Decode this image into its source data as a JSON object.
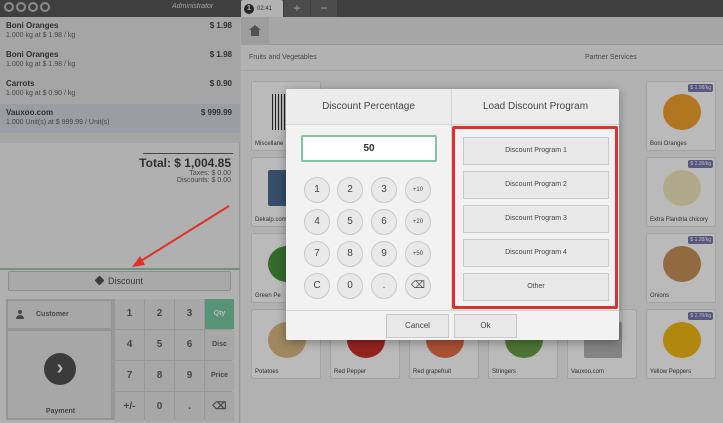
{
  "topbar": {
    "user": "Administrator",
    "order_number": "1",
    "order_time": "02:41",
    "add_order_glyph": "+",
    "remove_order_glyph": "−"
  },
  "orderlines": [
    {
      "name": "Boni Oranges",
      "price": "$ 1.98",
      "info": "1.000 kg at $ 1.98 / kg"
    },
    {
      "name": "Boni Oranges",
      "price": "$ 1.98",
      "info": "1.000 kg at $ 1.98 / kg"
    },
    {
      "name": "Carrots",
      "price": "$ 0.90",
      "info": "1.000 kg at $ 0.90 / kg"
    },
    {
      "name": "Vauxoo.com",
      "price": "$ 999.99",
      "info": "1.000 Unit(s) at $ 999.99 / Unit(s)"
    }
  ],
  "totals": {
    "total": "Total: $ 1,004.85",
    "taxes": "Taxes: $ 0.00",
    "discounts": "Discounts: $ 0.00"
  },
  "discount_button": "Discount",
  "actionpad": {
    "customer": "Customer",
    "payment": "Payment",
    "payment_glyph": "›"
  },
  "numpad": [
    "1",
    "2",
    "3",
    "Qty",
    "4",
    "5",
    "6",
    "Disc",
    "7",
    "8",
    "9",
    "Price",
    "+/-",
    "0",
    ".",
    "⌫"
  ],
  "products_header": {
    "category_left": "Fruits and Vegetables",
    "category_right": "Partner Services"
  },
  "product_tiles": [
    {
      "name": "Miscellane",
      "price": ""
    },
    {
      "name": "Boni Oranges",
      "price": "$ 1.98/kg"
    },
    {
      "name": "Dekalp.com",
      "price": ""
    },
    {
      "name": "Extra Flandria chicory",
      "price": "$ 2.20/kg"
    },
    {
      "name": "Green Pe",
      "price": ""
    },
    {
      "name": "Onions",
      "price": "$ 1.28/kg"
    },
    {
      "name": "Potatoes",
      "price": ""
    },
    {
      "name": "Red Pepper",
      "price": ""
    },
    {
      "name": "Red grapefruit",
      "price": ""
    },
    {
      "name": "Stringers",
      "price": ""
    },
    {
      "name": "Vauxoo.com",
      "price": ""
    },
    {
      "name": "Yellow Peppers",
      "price": "$ 2.70/kg"
    }
  ],
  "popup": {
    "tab_percentage": "Discount Percentage",
    "tab_program": "Load Discount Program",
    "input_value": "50",
    "keys": [
      "1",
      "2",
      "3",
      "+10",
      "4",
      "5",
      "6",
      "+20",
      "7",
      "8",
      "9",
      "+50",
      "C",
      "0",
      ".",
      "⌫"
    ],
    "programs": [
      "Discount Program 1",
      "Discount Program 2",
      "Discount Program 3",
      "Discount Program 4",
      "Other"
    ],
    "cancel": "Cancel",
    "ok": "Ok"
  },
  "colors": {
    "highlight": "#e0302a",
    "accent_green": "#6ec89b",
    "price_badge": "#6e6ea8"
  }
}
